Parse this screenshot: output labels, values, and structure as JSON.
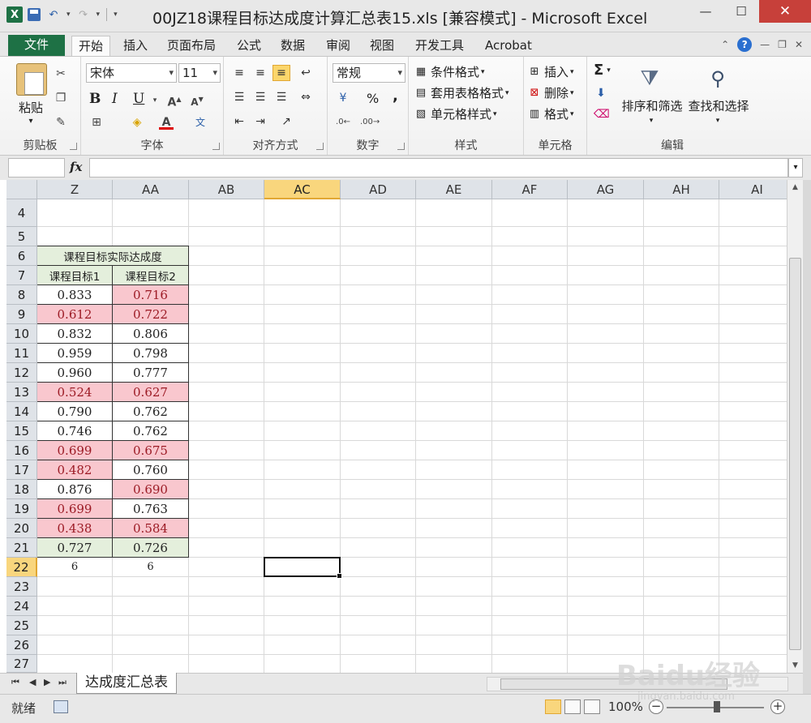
{
  "window": {
    "title": "00JZ18课程目标达成度计算汇总表15.xls  [兼容模式] - Microsoft Excel",
    "logo": "X"
  },
  "ribbon_tabs": [
    "文件",
    "开始",
    "插入",
    "页面布局",
    "公式",
    "数据",
    "审阅",
    "视图",
    "开发工具",
    "Acrobat"
  ],
  "active_tab": "开始",
  "groups": {
    "clipboard": {
      "label": "剪贴板",
      "paste": "粘贴"
    },
    "font": {
      "label": "字体",
      "font_name": "宋体",
      "font_size": "11",
      "bold": "B",
      "italic": "I",
      "underline": "U"
    },
    "alignment": {
      "label": "对齐方式"
    },
    "number": {
      "label": "数字",
      "format": "常规",
      "percent": "%",
      "comma": ","
    },
    "styles": {
      "label": "样式",
      "conditional": "条件格式",
      "table_format": "套用表格格式",
      "cell_styles": "单元格样式"
    },
    "cells": {
      "label": "单元格",
      "insert": "插入",
      "delete": "删除",
      "format": "格式"
    },
    "editing": {
      "label": "编辑",
      "sigma": "Σ",
      "sort_filter": "排序和筛选",
      "find_select": "查找和选择"
    }
  },
  "formula_bar": {
    "fx": "fx",
    "value": ""
  },
  "columns": [
    "Z",
    "AA",
    "AB",
    "AC",
    "AD",
    "AE",
    "AF",
    "AG",
    "AH",
    "AI"
  ],
  "selected_column": "AC",
  "rows": [
    "4",
    "5",
    "6",
    "7",
    "8",
    "9",
    "10",
    "11",
    "12",
    "13",
    "14",
    "15",
    "16",
    "17",
    "18",
    "19",
    "20",
    "21",
    "22",
    "23",
    "24",
    "25",
    "26",
    "27"
  ],
  "selected_row": "22",
  "table": {
    "title": "课程目标实际达成度",
    "headers": [
      "课程目标1",
      "课程目标2"
    ],
    "values": [
      [
        "0.833",
        "0.716"
      ],
      [
        "0.612",
        "0.722"
      ],
      [
        "0.832",
        "0.806"
      ],
      [
        "0.959",
        "0.798"
      ],
      [
        "0.960",
        "0.777"
      ],
      [
        "0.524",
        "0.627"
      ],
      [
        "0.790",
        "0.762"
      ],
      [
        "0.746",
        "0.762"
      ],
      [
        "0.699",
        "0.675"
      ],
      [
        "0.482",
        "0.760"
      ],
      [
        "0.876",
        "0.690"
      ],
      [
        "0.699",
        "0.763"
      ],
      [
        "0.438",
        "0.584"
      ]
    ],
    "highlight": [
      [
        false,
        true
      ],
      [
        true,
        true
      ],
      [
        false,
        false
      ],
      [
        false,
        false
      ],
      [
        false,
        false
      ],
      [
        true,
        true
      ],
      [
        false,
        false
      ],
      [
        false,
        false
      ],
      [
        true,
        true
      ],
      [
        true,
        false
      ],
      [
        false,
        true
      ],
      [
        true,
        false
      ],
      [
        true,
        true
      ]
    ],
    "average": [
      "0.727",
      "0.726"
    ],
    "counts": [
      "6",
      "6"
    ]
  },
  "colors": {
    "highlight_fill": "#f9c7ce",
    "highlight_text": "#9c1b25",
    "header_fill": "#e4efdc",
    "excel_green": "#1e7145"
  },
  "sheet_tabs": [
    "达成度汇总表"
  ],
  "status": {
    "ready": "就绪",
    "zoom": "100%"
  },
  "watermark": {
    "brand": "Baidu经验",
    "url": "jingyan.baidu.com"
  }
}
